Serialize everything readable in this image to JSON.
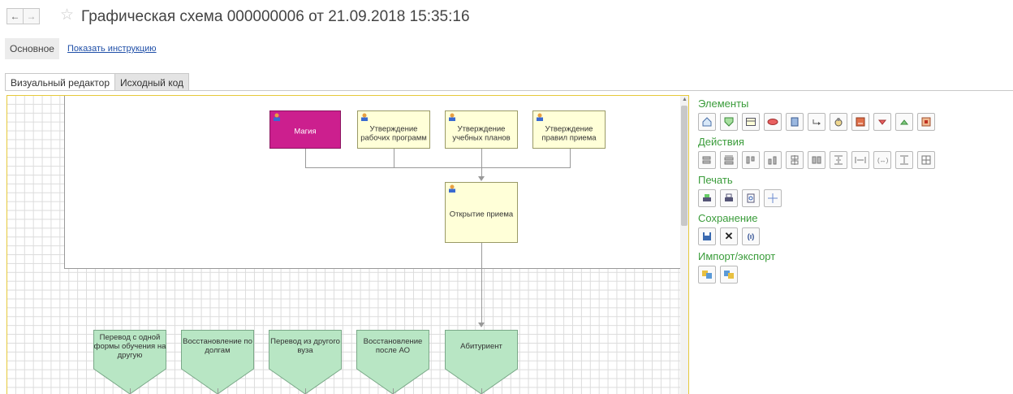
{
  "header": {
    "back_icon": "arrow-left-icon",
    "forward_icon": "arrow-right-icon",
    "favorite_icon": "star-icon",
    "title": "Графическая схема 000000006 от 21.09.2018 15:35:16"
  },
  "commandbar": {
    "main_label": "Основное",
    "instruction_link": "Показать инструкцию"
  },
  "tabs": [
    {
      "label": "Визуальный редактор",
      "active": true
    },
    {
      "label": "Исходный код",
      "active": false
    }
  ],
  "diagram": {
    "top_nodes": [
      {
        "label": "Магия",
        "color": "#cc1f8e"
      },
      {
        "label": "Утверждение рабочих программ",
        "color": "#ffffd8"
      },
      {
        "label": "Утверждение учебных планов",
        "color": "#ffffd8"
      },
      {
        "label": "Утверждение правил приема",
        "color": "#ffffd8"
      }
    ],
    "center_node": {
      "label": "Открытие приема",
      "color": "#ffffd8"
    },
    "green_nodes": [
      {
        "label": "Перевод с одной формы обучения на другую"
      },
      {
        "label": "Восстановление по долгам"
      },
      {
        "label": "Перевод из другого вуза"
      },
      {
        "label": "Восстановление после АО"
      },
      {
        "label": "Абитуриент"
      }
    ],
    "green_color": "#b8e6c4"
  },
  "panel": {
    "accent": "#3a9c3a",
    "elements": {
      "title": "Элементы",
      "icons": [
        "start-icon",
        "end-icon",
        "activity-icon",
        "condition-icon",
        "split-icon",
        "connector-icon",
        "subprocess-icon",
        "processing-icon",
        "merge-icon",
        "decision-icon",
        "stop-icon"
      ]
    },
    "actions": {
      "title": "Действия",
      "icons": [
        "align-left-icon",
        "align-right-icon",
        "align-top-icon",
        "align-bottom-icon",
        "align-center-h-icon",
        "align-center-v-icon",
        "distribute-v-icon",
        "distribute-h-icon",
        "equal-spacing-icon",
        "equal-height-icon",
        "center-icon"
      ]
    },
    "print": {
      "title": "Печать",
      "icons": [
        "print-setup-icon",
        "print-icon",
        "print-preview-icon",
        "page-layout-icon"
      ]
    },
    "save": {
      "title": "Сохранение",
      "icons": [
        "save-icon",
        "cancel-icon",
        "export-source-icon"
      ],
      "glyphs": {
        "cancel": "✕",
        "source": "(ı)"
      }
    },
    "import_export": {
      "title": "Импорт/экспорт",
      "icons": [
        "import-icon",
        "export-icon"
      ]
    }
  }
}
